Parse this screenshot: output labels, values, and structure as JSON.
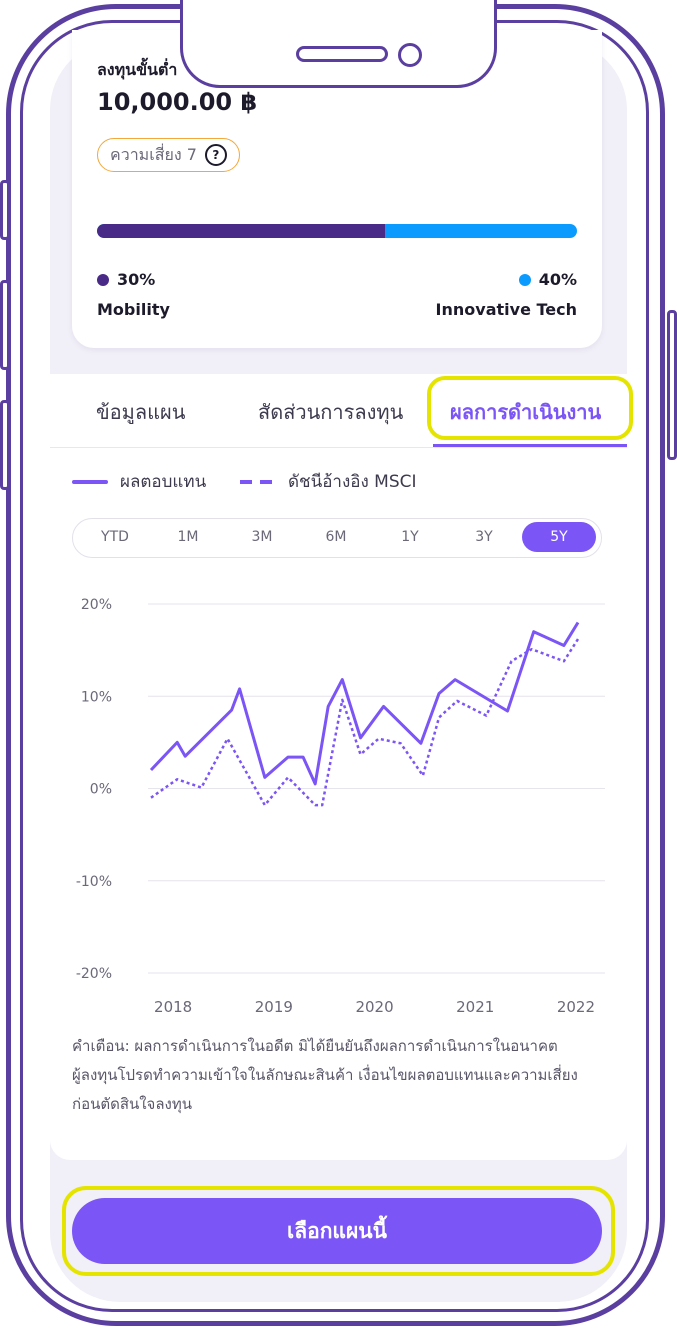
{
  "plan": {
    "min_label": "ลงทุนขั้นต่ำ",
    "min_amount": "10,000.00 ฿",
    "risk_label": "ความเสี่ยง 7",
    "help_symbol": "?",
    "allocation": [
      {
        "percent_text": "30%",
        "name": "Mobility",
        "color": "#4a2a87",
        "fraction": 0.6
      },
      {
        "percent_text": "40%",
        "name": "Innovative Tech",
        "color": "#0b9bff",
        "fraction": 0.4
      }
    ]
  },
  "tabs": [
    "ข้อมูลแผน",
    "สัดส่วนการลงทุน",
    "ผลการดำเนินงาน"
  ],
  "active_tab": 2,
  "legend": {
    "solid": "ผลตอบแทน",
    "dashed": "ดัชนีอ้างอิง MSCI"
  },
  "periods": [
    "YTD",
    "1M",
    "3M",
    "6M",
    "1Y",
    "3Y",
    "5Y"
  ],
  "active_period": 6,
  "chart_data": {
    "type": "line",
    "y_ticks": [
      "20%",
      "10%",
      "0%",
      "-10%",
      "-20%"
    ],
    "x_ticks": [
      "2018",
      "2019",
      "2020",
      "2021",
      "2022"
    ],
    "ylim": [
      -20,
      20
    ],
    "xlim": [
      2017.81,
      2022.08
    ],
    "grid": true,
    "series": [
      {
        "name": "ผลตอบแทน",
        "style": "solid",
        "color": "#7b55f5",
        "x": [
          2017.82,
          2018.08,
          2018.16,
          2018.62,
          2018.7,
          2018.95,
          2019.18,
          2019.33,
          2019.45,
          2019.58,
          2019.72,
          2019.9,
          2020.13,
          2020.5,
          2020.68,
          2020.84,
          2021.36,
          2021.62,
          2021.92,
          2022.06
        ],
        "y": [
          2,
          5,
          3.5,
          8.5,
          10.8,
          1.2,
          3.4,
          3.4,
          0.5,
          8.9,
          11.8,
          5.5,
          8.9,
          4.9,
          10.3,
          11.8,
          8.4,
          17,
          15.5,
          18
        ]
      },
      {
        "name": "ดัชนีอ้างอิง MSCI",
        "style": "dashed",
        "color": "#7b55f5",
        "x": [
          2017.82,
          2018.08,
          2018.32,
          2018.58,
          2018.95,
          2019.18,
          2019.45,
          2019.52,
          2019.72,
          2019.9,
          2020.08,
          2020.3,
          2020.52,
          2020.68,
          2020.86,
          2021.15,
          2021.4,
          2021.6,
          2021.92,
          2022.06
        ],
        "y": [
          -1,
          1,
          0.1,
          5.4,
          -1.8,
          1.2,
          -1.8,
          -1.8,
          9.6,
          3.7,
          5.4,
          4.9,
          1.4,
          7.7,
          9.5,
          7.9,
          13.8,
          15.1,
          13.8,
          16.2
        ]
      }
    ]
  },
  "disclaimer": [
    "คำเตือน: ผลการดำเนินการในอดีต มิได้ยืนยันถึงผลการดำเนินการในอนาคต",
    "ผู้ลงทุนโปรดทำความเข้าใจในลักษณะสินค้า เงื่อนไขผลตอบแทนและความเสี่ยง",
    "ก่อนตัดสินใจลงทุน"
  ],
  "cta_label": "เลือกแผนนี้"
}
